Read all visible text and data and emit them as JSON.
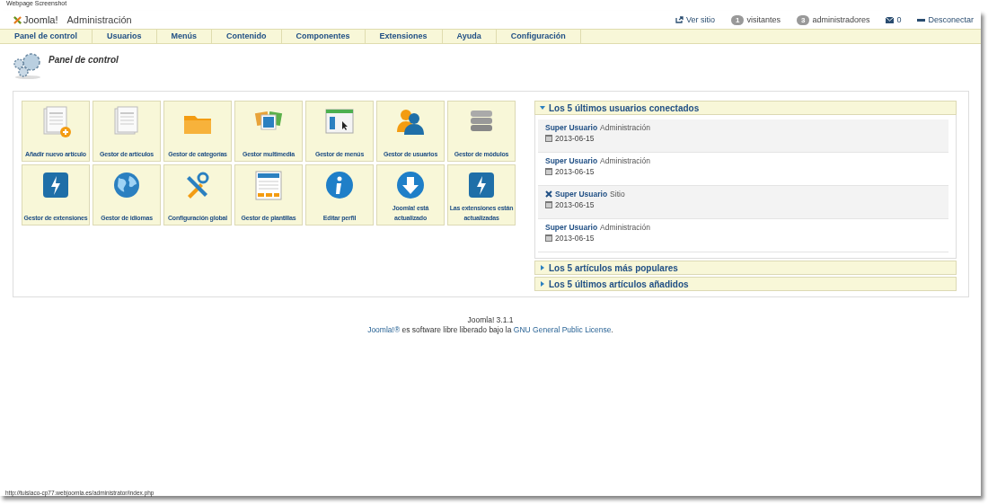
{
  "caption": "Webpage Screenshot",
  "header": {
    "logo": "Joomla!",
    "title": "Administración",
    "view_site": "Ver sitio",
    "visitors_count": "1",
    "visitors": "visitantes",
    "admins_count": "3",
    "admins": "administradores",
    "messages": "0",
    "logout": "Desconectar"
  },
  "menu": [
    "Panel de control",
    "Usuarios",
    "Menús",
    "Contenido",
    "Componentes",
    "Extensiones",
    "Ayuda",
    "Configuración"
  ],
  "page_title": "Panel de control",
  "tiles": [
    {
      "label": "Añadir nuevo artículo"
    },
    {
      "label": "Gestor de artículos"
    },
    {
      "label": "Gestor de categorías"
    },
    {
      "label": "Gestor multimedia"
    },
    {
      "label": "Gestor de menús"
    },
    {
      "label": "Gestor de usuarios"
    },
    {
      "label": "Gestor de módulos"
    },
    {
      "label": "Gestor de extensiones"
    },
    {
      "label": "Gestor de idiomas"
    },
    {
      "label": "Configuración global"
    },
    {
      "label": "Gestor de plantillas"
    },
    {
      "label": "Editar perfil"
    },
    {
      "label": "Joomla! está actualizado"
    },
    {
      "label": "Las extensiones están actualizadas"
    }
  ],
  "panels": [
    {
      "title": "Los 5 últimos usuarios conectados",
      "expanded": true,
      "users": [
        {
          "name": "Super Usuario",
          "client": "Administración",
          "kind": "admin",
          "date": "2013-06-15"
        },
        {
          "name": "Super Usuario",
          "client": "Administración",
          "kind": "admin",
          "date": "2013-06-15"
        },
        {
          "name": "Super Usuario",
          "client": "Sitio",
          "kind": "site",
          "date": "2013-06-15"
        },
        {
          "name": "Super Usuario",
          "client": "Administración",
          "kind": "admin",
          "date": "2013-06-15"
        }
      ]
    },
    {
      "title": "Los 5 artículos más populares",
      "expanded": false
    },
    {
      "title": "Los 5 últimos artículos añadidos",
      "expanded": false
    }
  ],
  "footer": {
    "version": "Joomla! 3.1.1",
    "license": {
      "product_link": "Joomla!®",
      "text": "es software libre liberado bajo la",
      "license_link": "GNU General Public License",
      "end": "."
    }
  },
  "status_bar": "http://tuislaco-cp77.webjoomla.es/administrator/index.php"
}
